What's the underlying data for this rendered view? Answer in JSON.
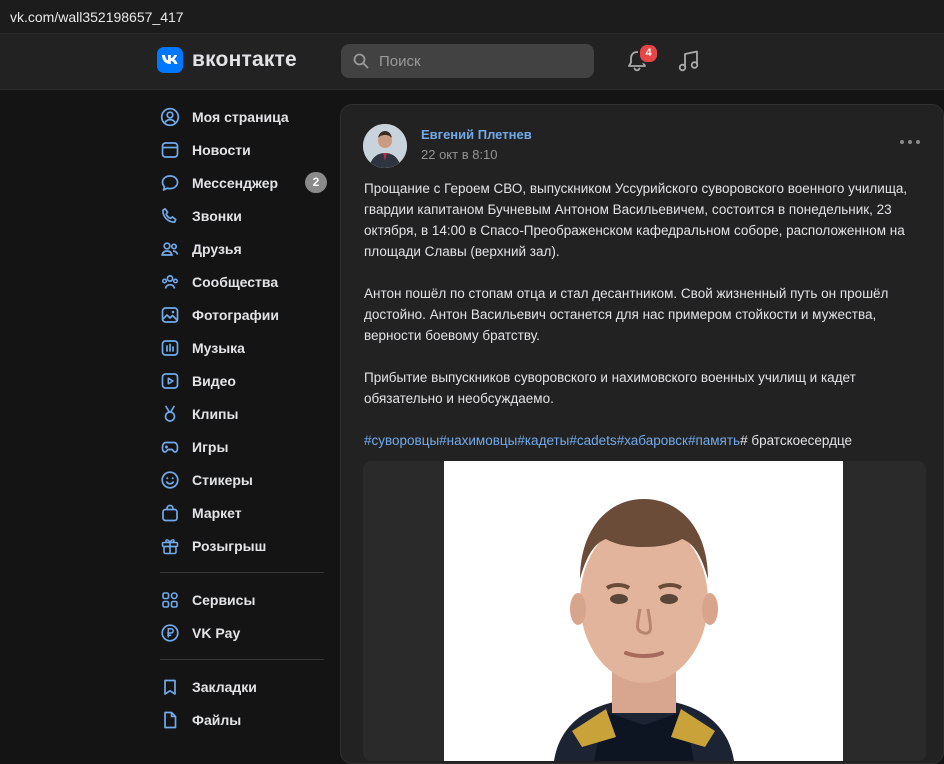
{
  "browser": {
    "url": "vk.com/wall352198657_417"
  },
  "header": {
    "logo_text": "вконтакте",
    "search_placeholder": "Поиск",
    "notifications_count": "4"
  },
  "sidebar": {
    "items": [
      {
        "label": "Моя страница"
      },
      {
        "label": "Новости"
      },
      {
        "label": "Мессенджер",
        "badge": "2"
      },
      {
        "label": "Звонки"
      },
      {
        "label": "Друзья"
      },
      {
        "label": "Сообщества"
      },
      {
        "label": "Фотографии"
      },
      {
        "label": "Музыка"
      },
      {
        "label": "Видео"
      },
      {
        "label": "Клипы"
      },
      {
        "label": "Игры"
      },
      {
        "label": "Стикеры"
      },
      {
        "label": "Маркет"
      },
      {
        "label": "Розыгрыш"
      }
    ],
    "extra": [
      {
        "label": "Сервисы"
      },
      {
        "label": "VK Pay"
      }
    ],
    "bottom": [
      {
        "label": "Закладки"
      },
      {
        "label": "Файлы"
      }
    ]
  },
  "post": {
    "author": "Евгений Плетнев",
    "date": "22 окт в 8:10",
    "paragraphs": [
      "Прощание с Героем СВО, выпускником Уссурийского суворовского военного училища, гвардии капитаном Бучневым Антоном Васильевичем, состоится в понедельник, 23 октября, в 14:00 в Спасо-Преображенском кафедральном соборе, расположенном на площади Славы (верхний зал).",
      "Антон пошёл по стопам отца и стал десантником. Свой жизненный путь он прошёл достойно. Антон Васильевич останется для нас примером стойкости и мужества, верности боевому братству.",
      "Прибытие выпускников суворовского и нахимовского военных училищ и кадет обязательно и необсуждаемо."
    ],
    "hashtags": [
      "#суворовцы",
      "#нахимовцы",
      "#кадеты",
      "#cadets",
      "#хабаровск",
      "#память"
    ],
    "hashtag_tail": "# братскоесердце"
  }
}
